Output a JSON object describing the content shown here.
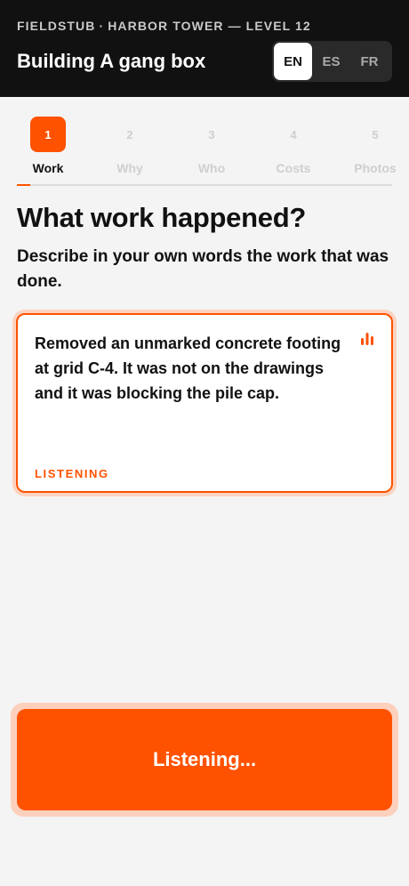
{
  "header": {
    "org": "FIELDSTUB",
    "separator": "·",
    "project": "HARBOR TOWER — LEVEL 12",
    "title": "Building A gang box",
    "languages": [
      {
        "code": "EN",
        "active": true
      },
      {
        "code": "ES",
        "active": false
      },
      {
        "code": "FR",
        "active": false
      }
    ]
  },
  "stepper": {
    "steps": [
      {
        "number": "1",
        "label": "Work",
        "active": true
      },
      {
        "number": "2",
        "label": "Why",
        "active": false
      },
      {
        "number": "3",
        "label": "Who",
        "active": false
      },
      {
        "number": "4",
        "label": "Costs",
        "active": false
      },
      {
        "number": "5",
        "label": "Photos",
        "active": false
      }
    ],
    "progress": 0.035
  },
  "question": {
    "title": "What work happened?",
    "subtitle": "Describe in your own words the work that was done."
  },
  "answer": {
    "text": "Removed an unmarked concrete footing at grid C-4. It was not on the drawings and it was blocking the pile cap.",
    "status": "LISTENING",
    "icon": "audio-bars-icon"
  },
  "action": {
    "label": "Listening..."
  },
  "colors": {
    "accent": "#ff5200",
    "header_bg": "#111111",
    "page_bg": "#f4f4f4"
  }
}
